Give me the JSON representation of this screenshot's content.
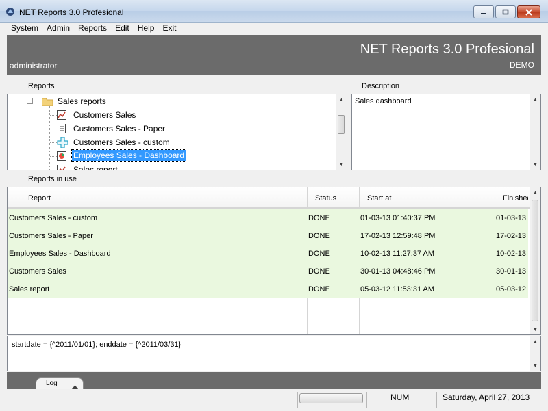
{
  "window": {
    "title": "NET Reports 3.0 Profesional"
  },
  "menu": [
    "System",
    "Admin",
    "Reports",
    "Edit",
    "Help",
    "Exit"
  ],
  "header": {
    "title": "NET Reports 3.0 Profesional",
    "user": "administrator",
    "edition": "DEMO"
  },
  "labels": {
    "reports": "Reports",
    "description": "Description",
    "reports_in_use": "Reports in use"
  },
  "tree": {
    "folder": "Sales reports",
    "items": [
      {
        "label": "Customers Sales",
        "icon": "chart-report-icon"
      },
      {
        "label": "Customers Sales - Paper",
        "icon": "paper-report-icon"
      },
      {
        "label": "Customers Sales - custom",
        "icon": "custom-report-icon"
      },
      {
        "label": "Employees Sales - Dashboard",
        "icon": "dashboard-report-icon",
        "selected": true
      },
      {
        "label": "Sales report",
        "icon": "chart-report-icon"
      }
    ]
  },
  "description_text": "Sales dashboard",
  "grid": {
    "columns": [
      "Report",
      "Status",
      "Start at",
      "Finished"
    ],
    "rows": [
      [
        "Customers Sales - custom",
        "DONE",
        "01-03-13 01:40:37 PM",
        "01-03-13"
      ],
      [
        "Customers Sales - Paper",
        "DONE",
        "17-02-13 12:59:48 PM",
        "17-02-13"
      ],
      [
        "Employees Sales - Dashboard",
        "DONE",
        "10-02-13 11:27:37 AM",
        "10-02-13"
      ],
      [
        "Customers Sales",
        "DONE",
        "30-01-13 04:48:46 PM",
        "30-01-13"
      ],
      [
        "Sales report",
        "DONE",
        "05-03-12 11:53:31 AM",
        "05-03-12"
      ]
    ]
  },
  "params_text": "startdate = {^2011/01/01}; enddate = {^2011/03/31}",
  "log_tab": "Log",
  "status": {
    "num": "NUM",
    "date": "Saturday, April 27, 2013"
  },
  "colors": {
    "header_bg": "#6b6b6b",
    "row_done_bg": "#eaf8df",
    "selection": "#3399ff"
  }
}
